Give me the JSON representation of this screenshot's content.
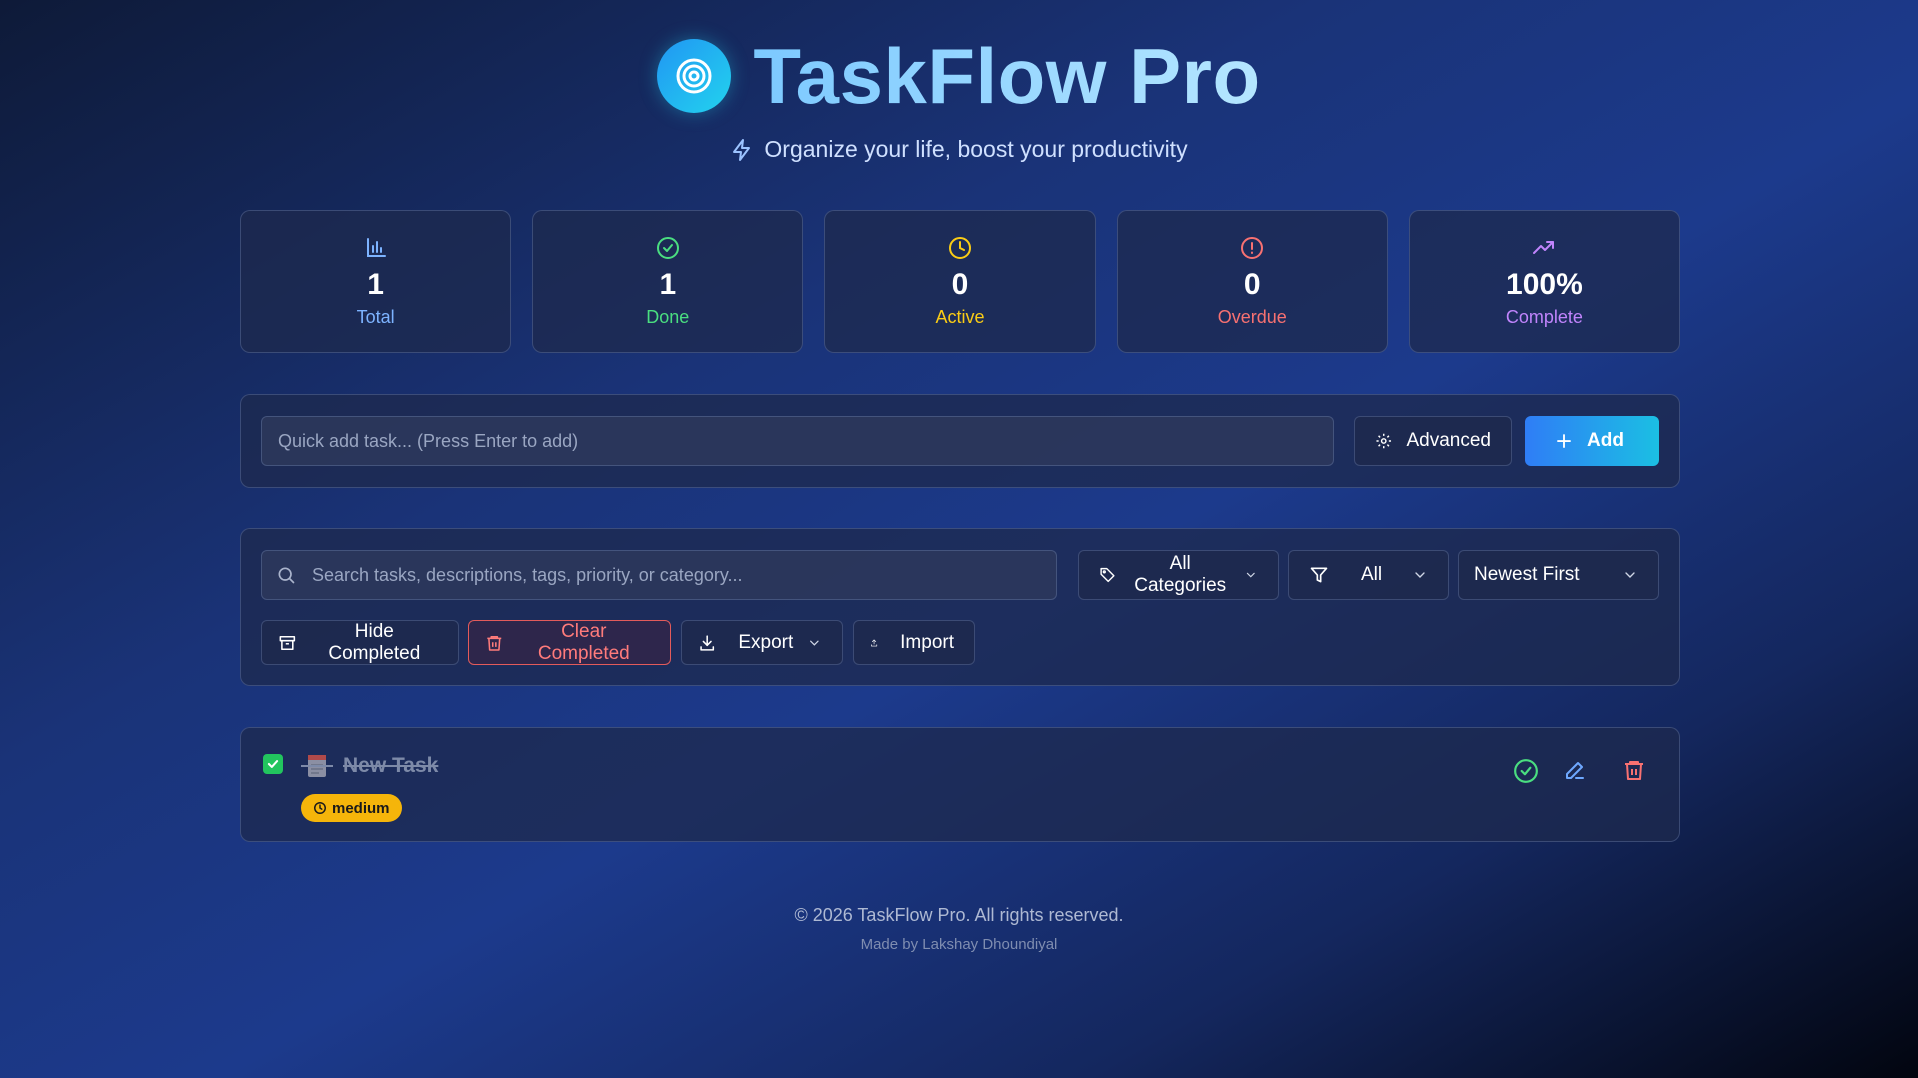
{
  "header": {
    "title": "TaskFlow Pro",
    "subtitle": "Organize your life, boost your productivity"
  },
  "stats": [
    {
      "value": "1",
      "label": "Total",
      "icon": "bar-chart-icon",
      "color": "#7db3ff"
    },
    {
      "value": "1",
      "label": "Done",
      "icon": "check-circle-icon",
      "color": "#4ade80"
    },
    {
      "value": "0",
      "label": "Active",
      "icon": "clock-icon",
      "color": "#facc15"
    },
    {
      "value": "0",
      "label": "Overdue",
      "icon": "alert-circle-icon",
      "color": "#f87171"
    },
    {
      "value": "100%",
      "label": "Complete",
      "icon": "trending-up-icon",
      "color": "#c084fc"
    }
  ],
  "quick_add": {
    "placeholder": "Quick add task... (Press Enter to add)",
    "advanced_label": "Advanced",
    "add_label": "Add"
  },
  "filters": {
    "search_placeholder": "Search tasks, descriptions, tags, priority, or category...",
    "category_selected": "All Categories",
    "status_selected": "All",
    "sort_selected": "Newest First",
    "hide_completed_label": "Hide Completed",
    "clear_completed_label": "Clear Completed",
    "export_label": "Export",
    "import_label": "Import"
  },
  "tasks": [
    {
      "title": "New Task",
      "priority": "medium",
      "completed": true
    }
  ],
  "footer": {
    "copyright": "© 2026 TaskFlow Pro. All rights reserved.",
    "credit": "Made by Lakshay Dhoundiyal"
  },
  "colors": {
    "accent": "#2f7df6",
    "success": "#22c55e",
    "danger": "#f87171",
    "priority_medium": "#f5b50a"
  }
}
